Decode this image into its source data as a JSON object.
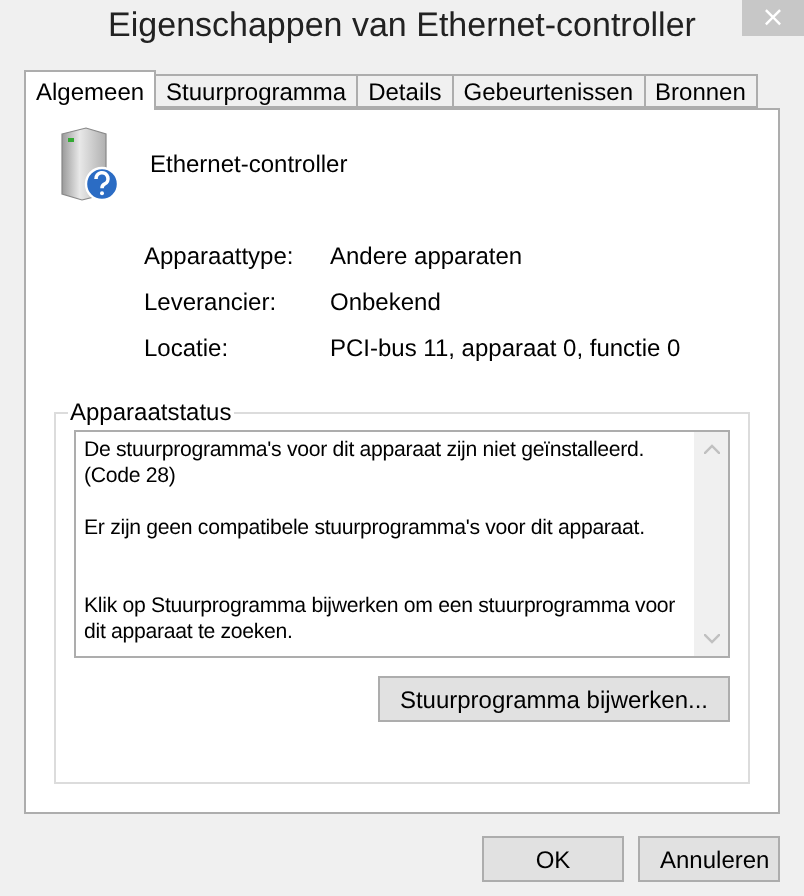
{
  "window": {
    "title": "Eigenschappen van Ethernet-controller",
    "close": "×"
  },
  "tabs": [
    {
      "label": "Algemeen",
      "selected": true
    },
    {
      "label": "Stuurprogramma",
      "selected": false
    },
    {
      "label": "Details",
      "selected": false
    },
    {
      "label": "Gebeurtenissen",
      "selected": false
    },
    {
      "label": "Bronnen",
      "selected": false
    }
  ],
  "device": {
    "name": "Ethernet-controller"
  },
  "properties": [
    {
      "label": "Apparaattype:",
      "value": "Andere apparaten"
    },
    {
      "label": "Leverancier:",
      "value": "Onbekend"
    },
    {
      "label": "Locatie:",
      "value": "PCI-bus 11, apparaat 0, functie 0"
    }
  ],
  "status": {
    "title": "Apparaatstatus",
    "paragraphs": [
      "De stuurprogramma's voor dit apparaat zijn niet geïnstalleerd. (Code 28)",
      "Er zijn geen compatibele stuurprogramma's voor dit apparaat.",
      "Klik op Stuurprogramma bijwerken om een stuurprogramma voor dit apparaat te zoeken."
    ],
    "button": "Stuurprogramma bijwerken..."
  },
  "buttons": [
    "OK",
    "Annuleren"
  ]
}
